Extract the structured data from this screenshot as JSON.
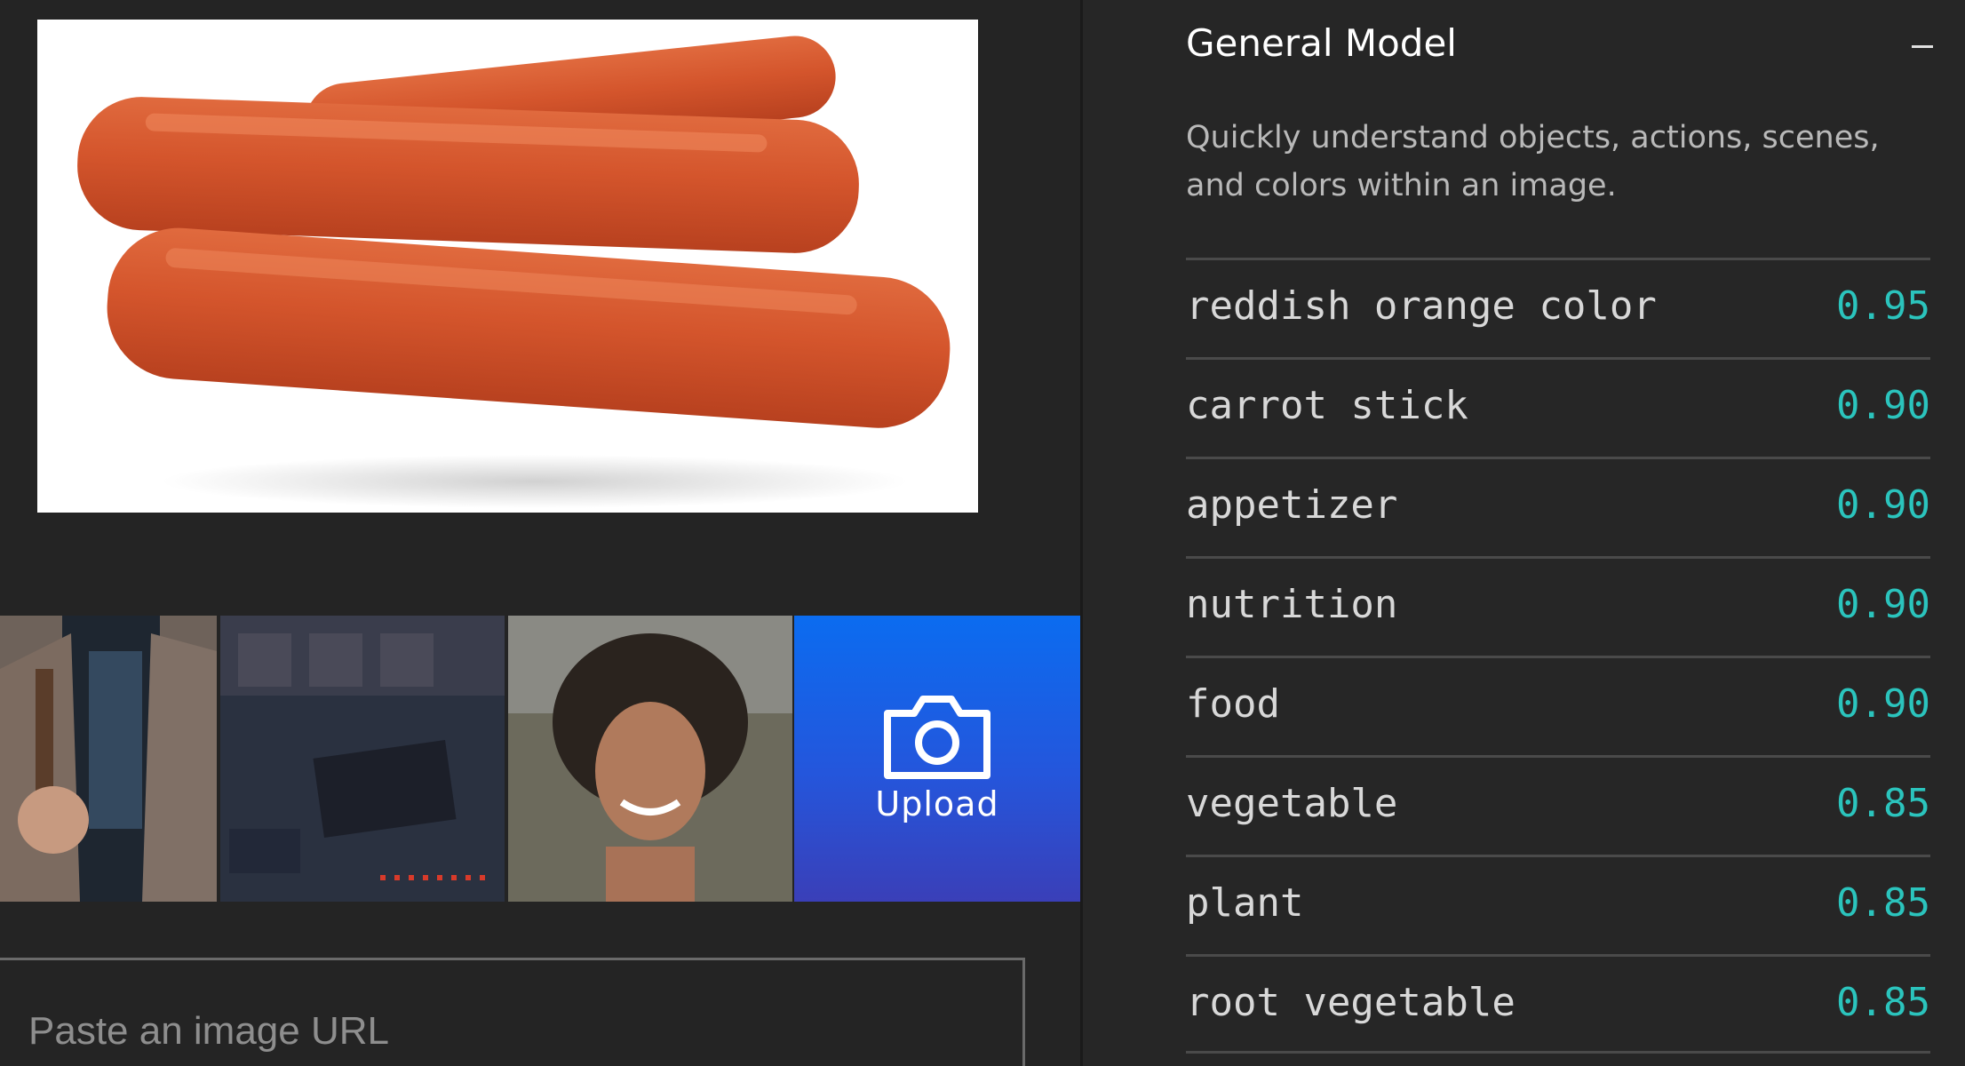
{
  "upload": {
    "label": "Upload"
  },
  "url_input": {
    "placeholder": "Paste an image URL",
    "value": ""
  },
  "model": {
    "title": "General Model",
    "description": "Quickly understand objects, actions, scenes, and colors within an image."
  },
  "concepts": [
    {
      "name": "reddish orange color",
      "value": "0.95"
    },
    {
      "name": "carrot stick",
      "value": "0.90"
    },
    {
      "name": "appetizer",
      "value": "0.90"
    },
    {
      "name": "nutrition",
      "value": "0.90"
    },
    {
      "name": "food",
      "value": "0.90"
    },
    {
      "name": "vegetable",
      "value": "0.85"
    },
    {
      "name": "plant",
      "value": "0.85"
    },
    {
      "name": "root vegetable",
      "value": "0.85"
    }
  ],
  "colors": {
    "accent": "#2bc4bd",
    "upload_blue": "#0b6cf0"
  }
}
